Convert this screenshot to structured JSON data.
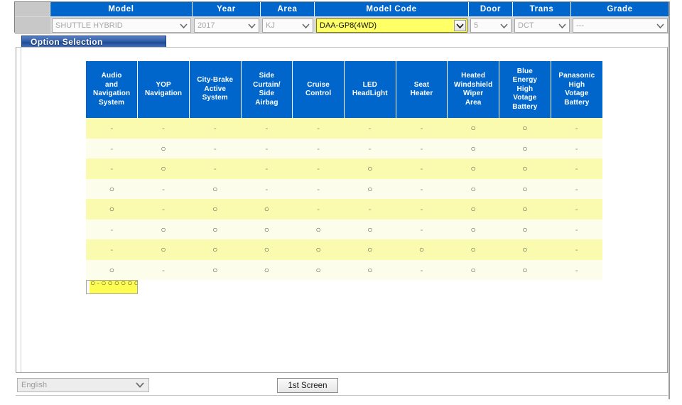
{
  "topbar": {
    "columns": [
      {
        "key": "spacer",
        "label": ""
      },
      {
        "key": "model",
        "label": "Model"
      },
      {
        "key": "year",
        "label": "Year"
      },
      {
        "key": "area",
        "label": "Area"
      },
      {
        "key": "model_code",
        "label": "Model Code"
      },
      {
        "key": "door",
        "label": "Door"
      },
      {
        "key": "trans",
        "label": "Trans"
      },
      {
        "key": "grade",
        "label": "Grade"
      }
    ],
    "model_value": "SHUTTLE HYBRID",
    "year_value": "2017",
    "area_value": "KJ",
    "model_code_value": "DAA-GP8(4WD)",
    "door_value": "5",
    "trans_value": "DCT",
    "grade_value": "---",
    "accent_blue": "#0066cc",
    "highlight_yellow": "#ffff66"
  },
  "tabs": {
    "option_selection": "Option Selection"
  },
  "matrix": {
    "columns": [
      "Audio and Navigation System",
      "YOP Navigation",
      "City-Brake Active System",
      "Side Curtain/ Side Airbag",
      "Cruise Control",
      "LED HeadLight",
      "Seat Heater",
      "Heated Windshield Wiper Area",
      "Blue Energy High Votage Battery",
      "Panasonic High Votage Battery"
    ],
    "column_lines": [
      [
        "Audio",
        "and",
        "Navigation",
        "System"
      ],
      [
        "YOP",
        "Navigation"
      ],
      [
        "City-Brake",
        "Active",
        "System"
      ],
      [
        "Side",
        "Curtain/",
        "Side",
        "Airbag"
      ],
      [
        "Cruise",
        "Control"
      ],
      [
        "LED",
        "HeadLight"
      ],
      [
        "Seat",
        "Heater"
      ],
      [
        "Heated",
        "Windshield",
        "Wiper",
        "Area"
      ],
      [
        "Blue",
        "Energy",
        "High",
        "Votage",
        "Battery"
      ],
      [
        "Panasonic",
        "High",
        "Votage",
        "Battery"
      ]
    ],
    "marker_circle": "○",
    "marker_dash": "-",
    "rows": [
      {
        "selected": false,
        "cells": [
          "-",
          "-",
          "-",
          "-",
          "-",
          "-",
          "-",
          "○",
          "○",
          "-"
        ]
      },
      {
        "selected": false,
        "cells": [
          "-",
          "○",
          "-",
          "-",
          "-",
          "-",
          "-",
          "○",
          "○",
          "-"
        ]
      },
      {
        "selected": false,
        "cells": [
          "-",
          "○",
          "-",
          "-",
          "-",
          "○",
          "-",
          "○",
          "○",
          "-"
        ]
      },
      {
        "selected": false,
        "cells": [
          "○",
          "-",
          "○",
          "-",
          "-",
          "○",
          "-",
          "○",
          "○",
          "-"
        ]
      },
      {
        "selected": false,
        "cells": [
          "○",
          "-",
          "○",
          "○",
          "-",
          "-",
          "-",
          "○",
          "○",
          "-"
        ]
      },
      {
        "selected": false,
        "cells": [
          "-",
          "○",
          "○",
          "○",
          "○",
          "○",
          "-",
          "○",
          "○",
          "-"
        ]
      },
      {
        "selected": false,
        "cells": [
          "-",
          "○",
          "○",
          "○",
          "○",
          "○",
          "○",
          "○",
          "○",
          "-"
        ]
      },
      {
        "selected": false,
        "cells": [
          "○",
          "-",
          "○",
          "○",
          "○",
          "○",
          "-",
          "○",
          "○",
          "-"
        ]
      },
      {
        "selected": true,
        "cells": [
          "○",
          "-",
          "○",
          "○",
          "○",
          "○",
          "○",
          "○",
          "○",
          "-"
        ]
      }
    ]
  },
  "bottom": {
    "language_value": "English",
    "screen_button": "1st Screen"
  }
}
